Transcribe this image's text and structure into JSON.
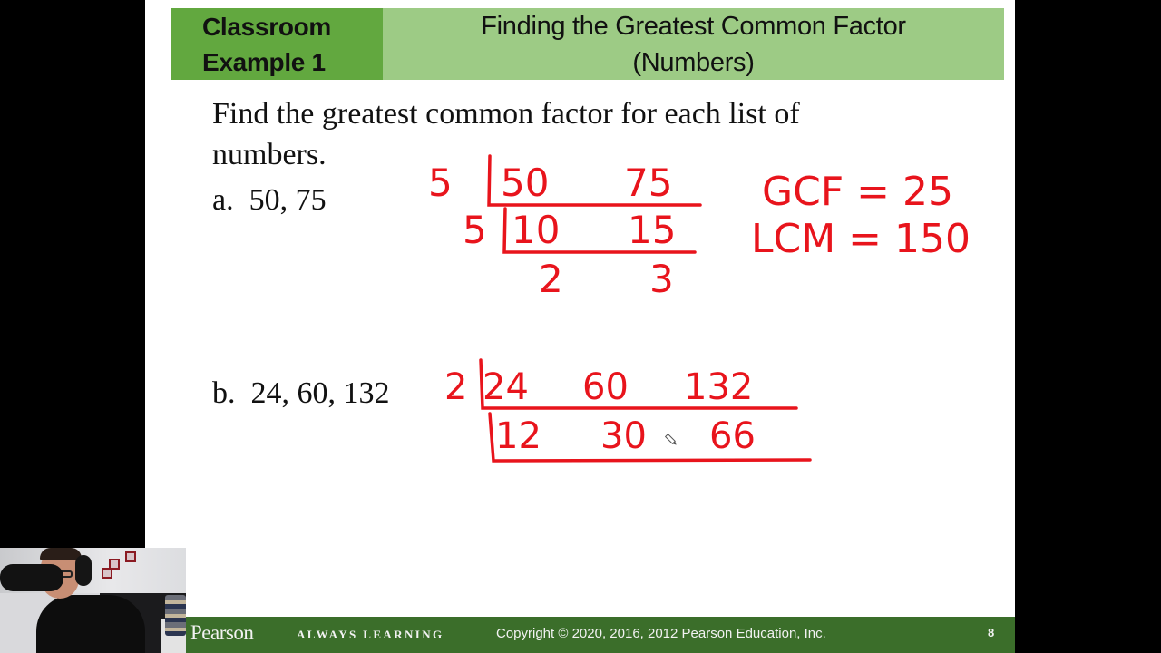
{
  "slide": {
    "title_label": [
      "Classroom",
      "Example 1"
    ],
    "title_main": [
      "Finding the Greatest Common Factor",
      "(Numbers)"
    ],
    "prompt": "Find the greatest common factor for each list of numbers.",
    "problems": [
      {
        "label": "a.",
        "numbers": "50, 75"
      },
      {
        "label": "b.",
        "numbers": "24, 60, 132"
      }
    ],
    "colors": {
      "title_label_bg": "#62a83f",
      "title_main_bg": "#9dcb85",
      "footer_bg": "#3b6e2a",
      "ink": "#e8141c"
    }
  },
  "annotations": {
    "problem_a": {
      "rows": [
        {
          "divisor": "5",
          "values": [
            "50",
            "75"
          ]
        },
        {
          "divisor": "5",
          "values": [
            "10",
            "15"
          ]
        },
        {
          "divisor": "",
          "values": [
            "2",
            "3"
          ]
        }
      ],
      "gcf": "GCF = 25",
      "lcm": "LCM = 150"
    },
    "problem_b": {
      "rows": [
        {
          "divisor": "2",
          "values": [
            "24",
            "60",
            "132"
          ]
        },
        {
          "divisor": "",
          "values": [
            "12",
            "30",
            "66"
          ]
        }
      ]
    }
  },
  "footer": {
    "logo": "Pearson",
    "tagline": "ALWAYS LEARNING",
    "copyright": "Copyright © 2020, 2016, 2012 Pearson Education, Inc.",
    "page_number": "8"
  },
  "overlay": {
    "webcam": "presenter-webcam",
    "cursor": "pen-cursor"
  }
}
